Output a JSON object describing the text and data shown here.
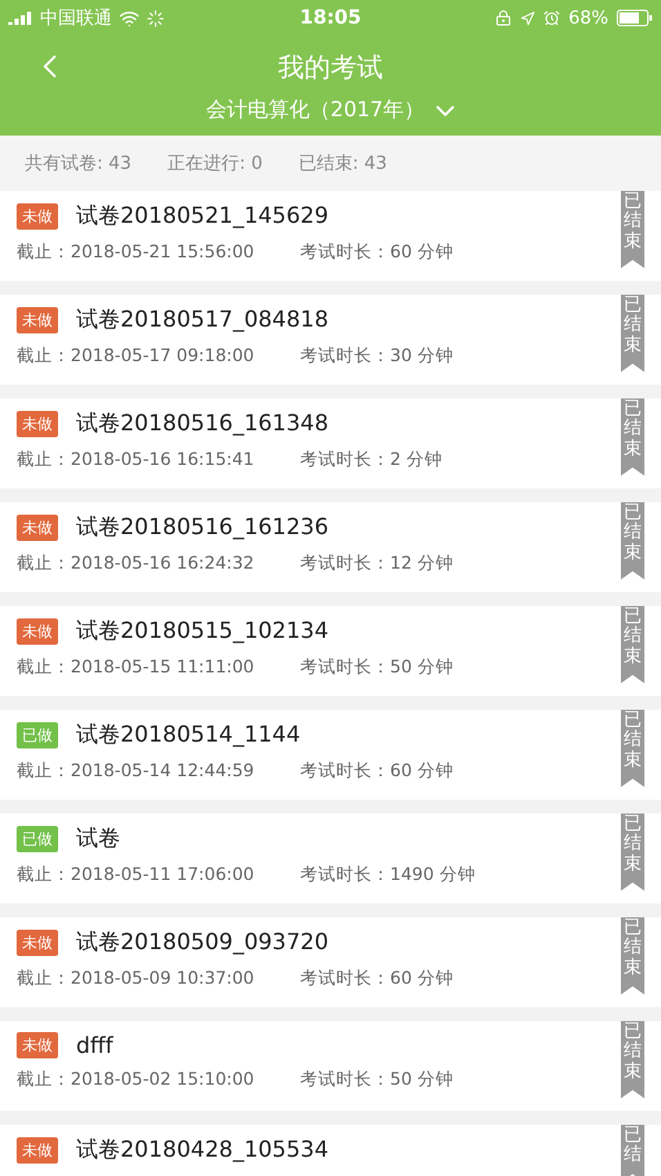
{
  "status_bar": {
    "carrier": "中国联通",
    "time": "18:05",
    "battery": "68%"
  },
  "header": {
    "title": "我的考试",
    "subtitle": "会计电算化（2017年）"
  },
  "summary": [
    "共有试卷: 43",
    "正在进行: 0",
    "已结束: 43"
  ],
  "exams": [
    {
      "kind": "todo",
      "tag": "未做",
      "title": "试卷20180521_145629",
      "deadline": "截止：2018-05-21 15:56:00",
      "duration": "考试时长：60 分钟",
      "ribbon": "已结束"
    },
    {
      "kind": "todo",
      "tag": "未做",
      "title": "试卷20180517_084818",
      "deadline": "截止：2018-05-17 09:18:00",
      "duration": "考试时长：30 分钟",
      "ribbon": "已结束"
    },
    {
      "kind": "todo",
      "tag": "未做",
      "title": "试卷20180516_161348",
      "deadline": "截止：2018-05-16 16:15:41",
      "duration": "考试时长：2 分钟",
      "ribbon": "已结束"
    },
    {
      "kind": "todo",
      "tag": "未做",
      "title": "试卷20180516_161236",
      "deadline": "截止：2018-05-16 16:24:32",
      "duration": "考试时长：12 分钟",
      "ribbon": "已结束"
    },
    {
      "kind": "todo",
      "tag": "未做",
      "title": "试卷20180515_102134",
      "deadline": "截止：2018-05-15 11:11:00",
      "duration": "考试时长：50 分钟",
      "ribbon": "已结束"
    },
    {
      "kind": "done",
      "tag": "已做",
      "title": "试卷20180514_1144",
      "deadline": "截止：2018-05-14 12:44:59",
      "duration": "考试时长：60 分钟",
      "ribbon": "已结束"
    },
    {
      "kind": "done",
      "tag": "已做",
      "title": "试卷",
      "deadline": "截止：2018-05-11 17:06:00",
      "duration": "考试时长：1490 分钟",
      "ribbon": "已结束"
    },
    {
      "kind": "todo",
      "tag": "未做",
      "title": "试卷20180509_093720",
      "deadline": "截止：2018-05-09 10:37:00",
      "duration": "考试时长：60 分钟",
      "ribbon": "已结束"
    },
    {
      "kind": "todo",
      "tag": "未做",
      "title": "dfff",
      "deadline": "截止：2018-05-02 15:10:00",
      "duration": "考试时长：50 分钟",
      "ribbon": "已结束"
    },
    {
      "kind": "todo",
      "tag": "未做",
      "title": "试卷20180428_105534",
      "ribbon": "已结"
    }
  ]
}
